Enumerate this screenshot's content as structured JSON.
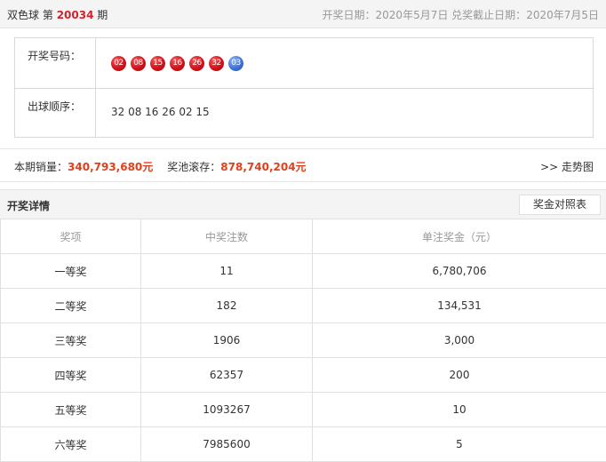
{
  "header": {
    "game_name": "双色球",
    "issue_prefix": "第",
    "issue_number": "20034",
    "issue_suffix": "期",
    "draw_date_label": "开奖日期：",
    "draw_date": "2020年5月7日",
    "deadline_label": "兑奖截止日期：",
    "deadline_date": "2020年7月5日"
  },
  "draw": {
    "numbers_label": "开奖号码：",
    "red_balls": [
      "02",
      "08",
      "15",
      "16",
      "26",
      "32"
    ],
    "blue_ball": "03",
    "order_label": "出球顺序：",
    "order_value": "32 08 16 26 02 15"
  },
  "sales": {
    "sales_label": "本期销量：",
    "sales_amount": "340,793,680元",
    "pool_label": "奖池滚存：",
    "pool_amount": "878,740,204元",
    "trend_link": ">> 走势图"
  },
  "details": {
    "title": "开奖详情",
    "compare_button": "奖金对照表",
    "columns": [
      "奖项",
      "中奖注数",
      "单注奖金（元）"
    ],
    "rows": [
      {
        "prize": "一等奖",
        "count": "11",
        "amount": "6,780,706"
      },
      {
        "prize": "二等奖",
        "count": "182",
        "amount": "134,531"
      },
      {
        "prize": "三等奖",
        "count": "1906",
        "amount": "3,000"
      },
      {
        "prize": "四等奖",
        "count": "62357",
        "amount": "200"
      },
      {
        "prize": "五等奖",
        "count": "1093267",
        "amount": "10"
      },
      {
        "prize": "六等奖",
        "count": "7985600",
        "amount": "5"
      }
    ]
  }
}
